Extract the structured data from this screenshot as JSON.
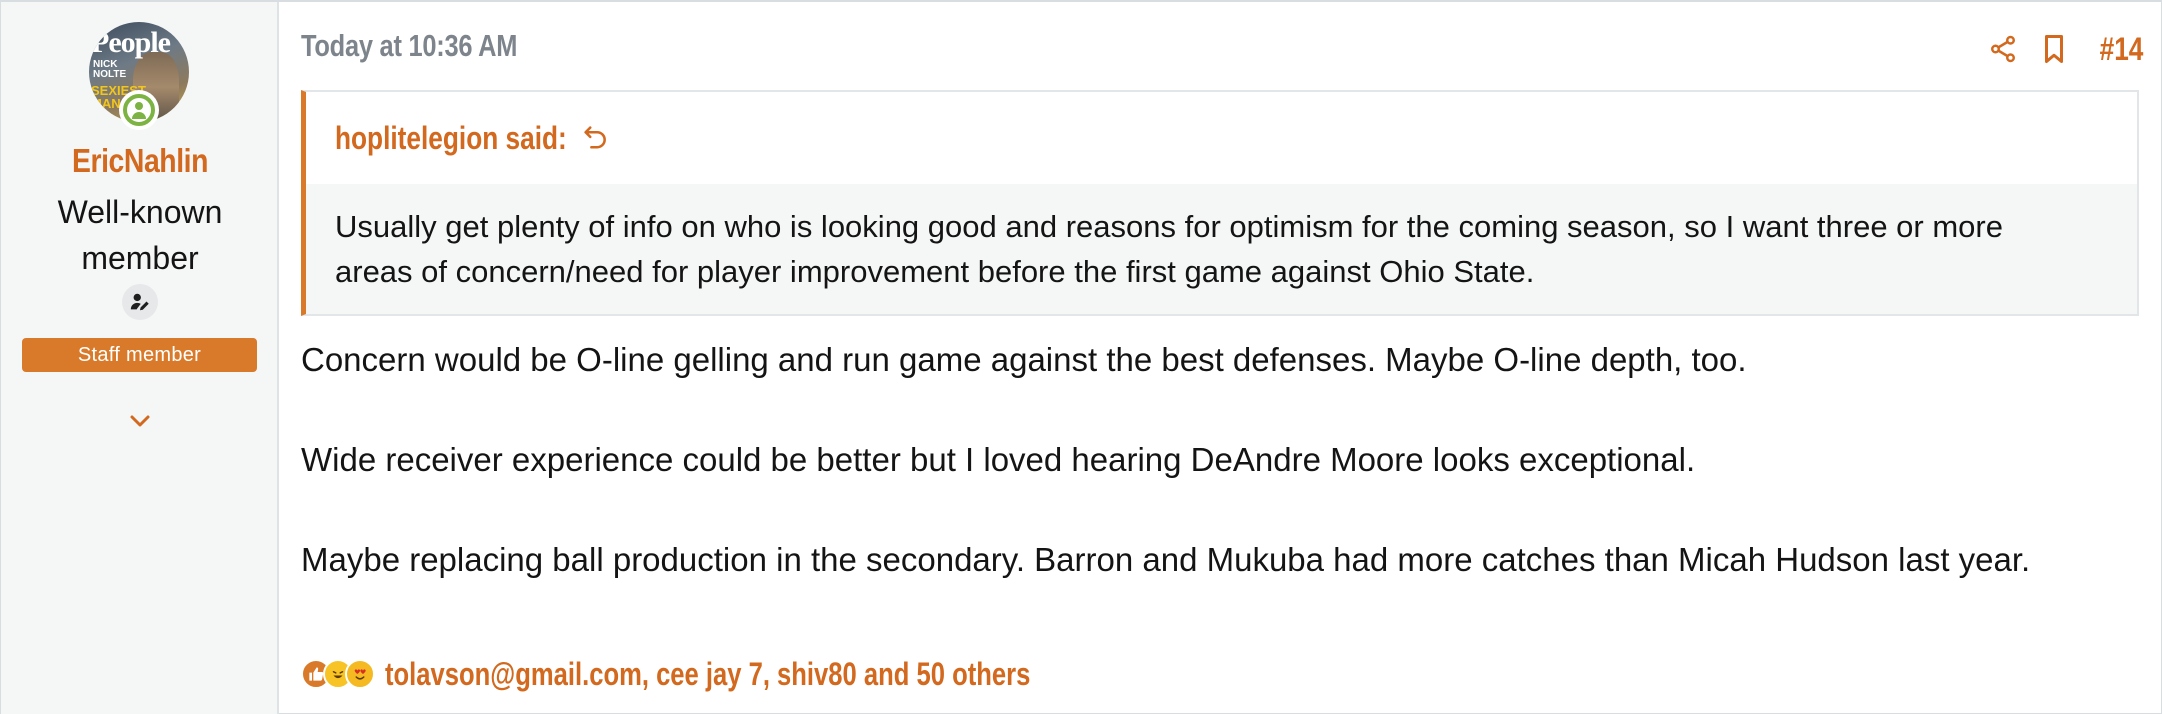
{
  "user": {
    "avatar_lines": {
      "title": "People",
      "sub": "NICK NOLTE",
      "tag": "SEXIEST MAN"
    },
    "username": "EricNahlin",
    "title": "Well-known member",
    "staff_badge": "Staff member",
    "status": "online"
  },
  "post": {
    "timestamp": "Today at 10:36 AM",
    "number": "#14",
    "actions": [
      "share-icon",
      "bookmark-icon"
    ]
  },
  "quote": {
    "author": "hoplitelegion said:",
    "text": "Usually get plenty of info on who is looking good and reasons for optimism for the coming season, so I want three or more areas of concern/need for player improvement before the first game against Ohio State."
  },
  "message": {
    "paragraphs": [
      "Concern would be O-line gelling and run game against the best defenses. Maybe O-line depth, too.",
      "Wide receiver experience could be better but I loved hearing DeAndre Moore looks exceptional.",
      "Maybe replacing ball production in the secondary. Barron and Mukuba had more catches than Micah Hudson last year."
    ]
  },
  "reactions": {
    "types": [
      "like",
      "haha",
      "love"
    ],
    "summary": "tolavson@gmail.com, cee jay 7, shiv80 and 50 others"
  },
  "colors": {
    "accent": "#d2691e",
    "badge": "#d97a2b",
    "online": "#7cb342",
    "timestamp": "#7d848b"
  }
}
